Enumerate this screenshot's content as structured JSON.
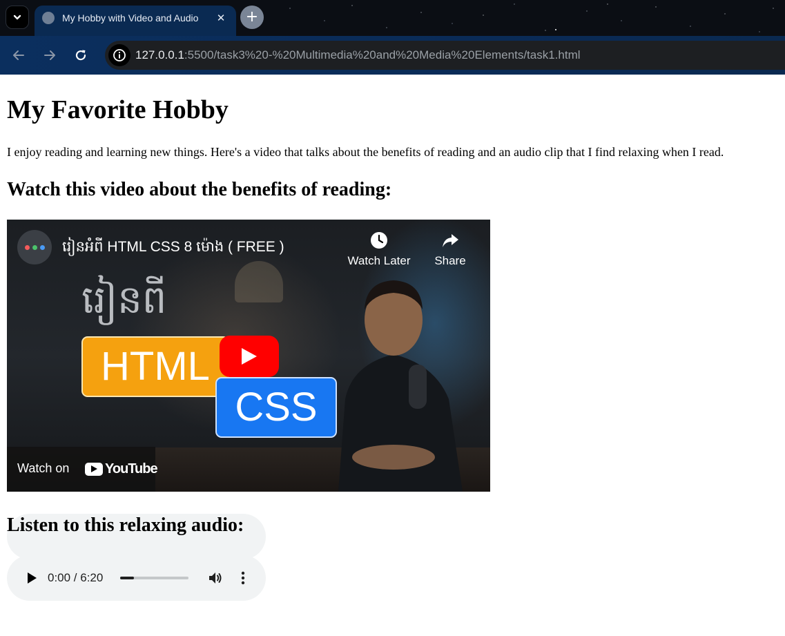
{
  "browser": {
    "tab": {
      "title": "My Hobby with Video and Audio",
      "close_glyph": "✕",
      "favicon": "globe-icon"
    },
    "new_tab_glyph": "+",
    "url_host": "127.0.0.1",
    "url_rest": ":5500/task3%20-%20Multimedia%20and%20Media%20Elements/task1.html",
    "colors": {
      "tab_active": "#0a2a52",
      "toolbar": "#0b2f5e",
      "omnibox": "#1d1f22"
    }
  },
  "page": {
    "heading": "My Favorite Hobby",
    "intro": "I enjoy reading and learning new things. Here's a video that talks about the benefits of reading and an audio clip that I find relaxing when I read.",
    "video_heading": "Watch this video about the benefits of reading:",
    "audio_heading": "Listen to this relaxing audio:"
  },
  "video": {
    "title": "រៀនអំពី HTML CSS 8 ម៉ោង ( FREE )",
    "watch_later_label": "Watch Later",
    "share_label": "Share",
    "thumbnail_khmer_text": "រៀនពី",
    "thumbnail_html_label": "HTML",
    "thumbnail_css_label": "CSS",
    "watch_on_label": "Watch on",
    "youtube_wordmark": "YouTube",
    "colors": {
      "html_badge": "#f5a10f",
      "css_badge": "#1877f2",
      "play_button": "#ff0000"
    }
  },
  "audio": {
    "time_display": "0:00 / 6:20",
    "progress": 0.2
  }
}
